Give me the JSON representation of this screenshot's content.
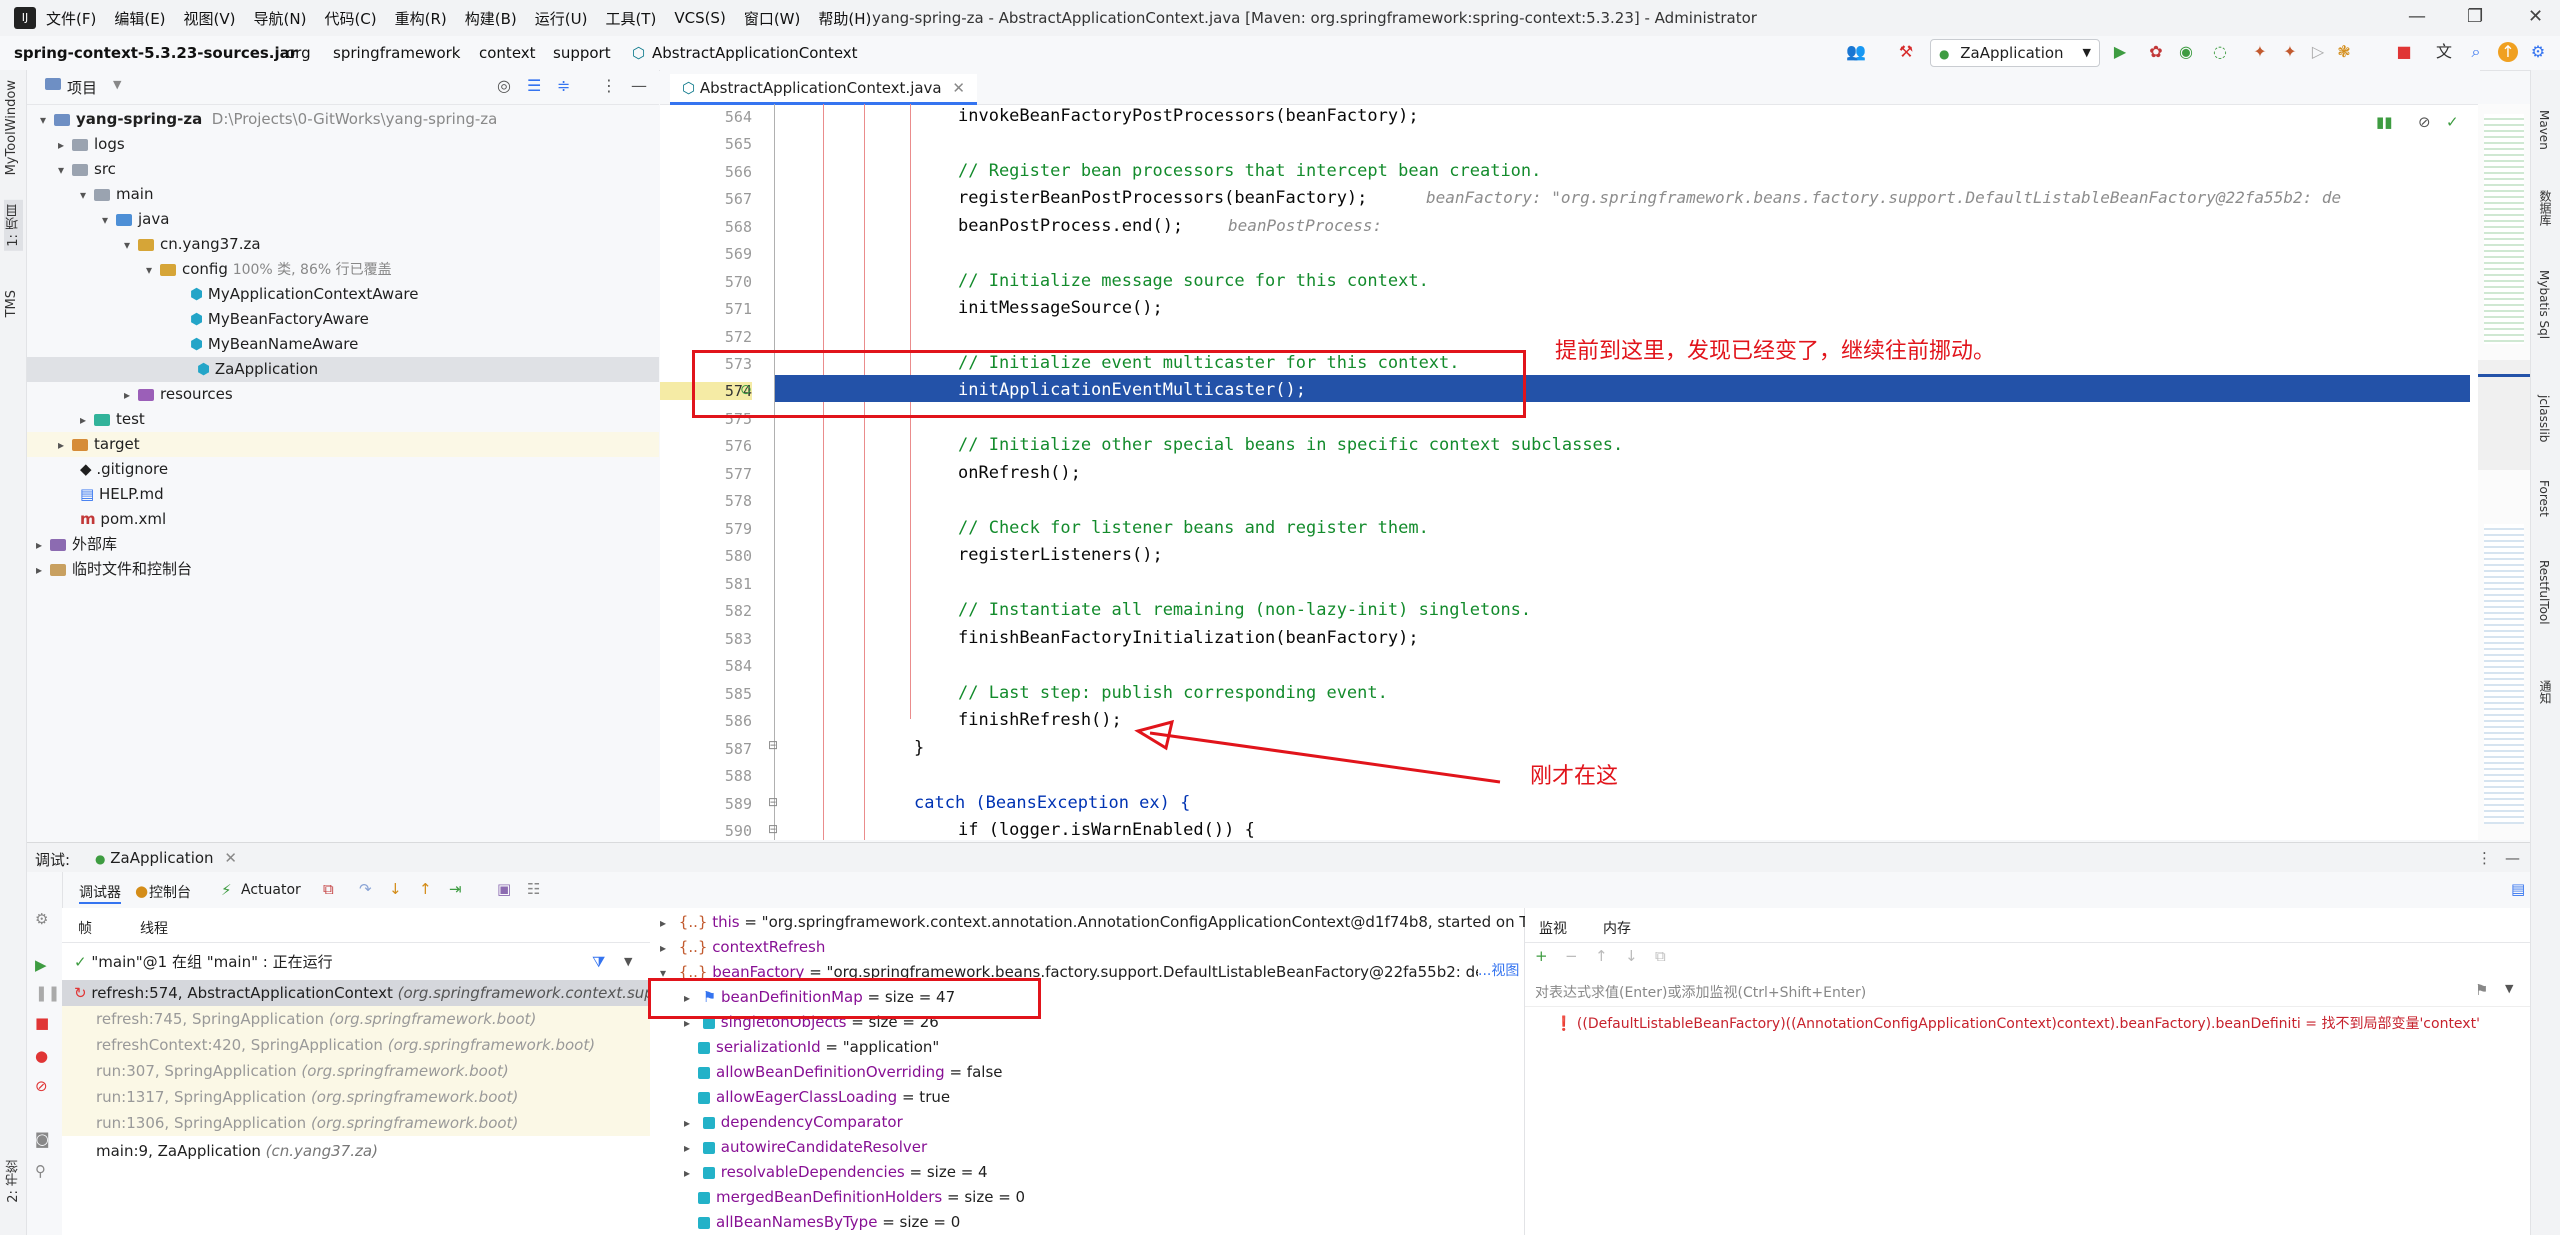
{
  "menubar": {
    "logo": "IJ",
    "items": [
      "文件(F)",
      "编辑(E)",
      "视图(V)",
      "导航(N)",
      "代码(C)",
      "重构(R)",
      "构建(B)",
      "运行(U)",
      "工具(T)",
      "VCS(S)",
      "窗口(W)",
      "帮助(H)"
    ],
    "window_title": "yang-spring-za - AbstractApplicationContext.java [Maven: org.springframework:spring-context:5.3.23] - Administrator"
  },
  "navbar": {
    "crumbs": [
      "spring-context-5.3.23-sources.jar",
      "org",
      "springframework",
      "context",
      "support",
      "AbstractApplicationContext"
    ],
    "run_config": "ZaApplication"
  },
  "leftstripe": {
    "items": [
      "MyToolWindow",
      "1: 项目",
      "TMS",
      "2: 书签"
    ]
  },
  "project": {
    "title": "项目",
    "rows": [
      {
        "label": "yang-spring-za",
        "extra": "D:\\Projects\\0-GitWorks\\yang-spring-za"
      },
      {
        "label": "logs"
      },
      {
        "label": "src"
      },
      {
        "label": "main"
      },
      {
        "label": "java"
      },
      {
        "label": "cn.yang37.za"
      },
      {
        "label": "config",
        "extra": "100% 类, 86% 行已覆盖"
      },
      {
        "label": "MyApplicationContextAware"
      },
      {
        "label": "MyBeanFactoryAware"
      },
      {
        "label": "MyBeanNameAware"
      },
      {
        "label": "ZaApplication"
      },
      {
        "label": "resources"
      },
      {
        "label": "test"
      },
      {
        "label": "target"
      },
      {
        "label": ".gitignore"
      },
      {
        "label": "HELP.md"
      },
      {
        "label": "pom.xml"
      },
      {
        "label": "外部库"
      },
      {
        "label": "临时文件和控制台"
      }
    ]
  },
  "editor": {
    "tab": "AbstractApplicationContext.java",
    "lines": [
      {
        "n": "564",
        "code": "invokeBeanFactoryPostProcessors(beanFactory);"
      },
      {
        "n": "565",
        "code": ""
      },
      {
        "n": "566",
        "code": "// Register bean processors that intercept bean creation."
      },
      {
        "n": "567",
        "code": "registerBeanPostProcessors(beanFactory);",
        "hint": "beanFactory: \"org.springframework.beans.factory.support.DefaultListableBeanFactory@22fa55b2: de"
      },
      {
        "n": "568",
        "code": "beanPostProcess.end();",
        "hint": "beanPostProcess:"
      },
      {
        "n": "569",
        "code": ""
      },
      {
        "n": "570",
        "code": "// Initialize message source for this context."
      },
      {
        "n": "571",
        "code": "initMessageSource();"
      },
      {
        "n": "572",
        "code": ""
      },
      {
        "n": "573",
        "code": "// Initialize event multicaster for this context."
      },
      {
        "n": "574",
        "code": "initApplicationEventMulticaster();"
      },
      {
        "n": "575",
        "code": ""
      },
      {
        "n": "576",
        "code": "// Initialize other special beans in specific context subclasses."
      },
      {
        "n": "577",
        "code": "onRefresh();"
      },
      {
        "n": "578",
        "code": ""
      },
      {
        "n": "579",
        "code": "// Check for listener beans and register them."
      },
      {
        "n": "580",
        "code": "registerListeners();"
      },
      {
        "n": "581",
        "code": ""
      },
      {
        "n": "582",
        "code": "// Instantiate all remaining (non-lazy-init) singletons."
      },
      {
        "n": "583",
        "code": "finishBeanFactoryInitialization(beanFactory);"
      },
      {
        "n": "584",
        "code": ""
      },
      {
        "n": "585",
        "code": "// Last step: publish corresponding event."
      },
      {
        "n": "586",
        "code": "finishRefresh();"
      },
      {
        "n": "587",
        "code": "}"
      },
      {
        "n": "588",
        "code": ""
      },
      {
        "n": "589",
        "code": "catch (BeansException ex) {"
      },
      {
        "n": "590",
        "code": "if (logger.isWarnEnabled()) {"
      }
    ],
    "annotation_1": "提前到这里，发现已经变了，继续往前挪动。",
    "annotation_2": "刚才在这"
  },
  "rightstripe": {
    "items": [
      "Maven",
      "数据库",
      "Mybatis Sql",
      "jclasslib",
      "Forest",
      "RestfulTool",
      "通知"
    ]
  },
  "debug": {
    "label": "调试:",
    "session": "ZaApplication",
    "tabs": [
      "调试器",
      "控制台",
      "Actuator"
    ],
    "subtabs": [
      "帧",
      "线程"
    ],
    "thread": "\"main\"@1 在组 \"main\" : 正在运行",
    "frames": [
      {
        "method": "refresh:574, AbstractApplicationContext",
        "pkg": "(org.springframework.context.sup"
      },
      {
        "method": "refresh:745, SpringApplication",
        "pkg": "(org.springframework.boot)"
      },
      {
        "method": "refreshContext:420, SpringApplication",
        "pkg": "(org.springframework.boot)"
      },
      {
        "method": "run:307, SpringApplication",
        "pkg": "(org.springframework.boot)"
      },
      {
        "method": "run:1317, SpringApplication",
        "pkg": "(org.springframework.boot)"
      },
      {
        "method": "run:1306, SpringApplication",
        "pkg": "(org.springframework.boot)"
      },
      {
        "method": "main:9, ZaApplication",
        "pkg": "(cn.yang37.za)"
      }
    ],
    "vars": [
      {
        "name": "this",
        "value": " = \"org.springframework.context.annotation.AnnotationConfigApplicationContext@d1f74b8, started on Thu"
      },
      {
        "name": "contextRefresh",
        "value": ""
      },
      {
        "name": "beanFactory",
        "value": " = \"org.springframework.beans.factory.support.DefaultListableBeanFactory@22fa55b2: definir",
        "link": "...视图"
      },
      {
        "name": "beanDefinitionMap",
        "value": " =  size = 47"
      },
      {
        "name": "singletonObjects",
        "value": " =  size = 26"
      },
      {
        "name": "serializationId",
        "value": " = \"application\""
      },
      {
        "name": "allowBeanDefinitionOverriding",
        "value": " = false"
      },
      {
        "name": "allowEagerClassLoading",
        "value": " = true"
      },
      {
        "name": "dependencyComparator",
        "value": ""
      },
      {
        "name": "autowireCandidateResolver",
        "value": ""
      },
      {
        "name": "resolvableDependencies",
        "value": " =  size = 4"
      },
      {
        "name": "mergedBeanDefinitionHolders",
        "value": " =  size = 0"
      },
      {
        "name": "allBeanNamesByType",
        "value": " =  size = 0"
      }
    ],
    "watch_tabs": [
      "监视",
      "内存"
    ],
    "watch_placeholder": "对表达式求值(Enter)或添加监视(Ctrl+Shift+Enter)",
    "watch_expr": "((DefaultListableBeanFactory)((AnnotationConfigApplicationContext)context).beanFactory).beanDefiniti",
    "watch_error": "= 找不到局部变量'context'"
  }
}
